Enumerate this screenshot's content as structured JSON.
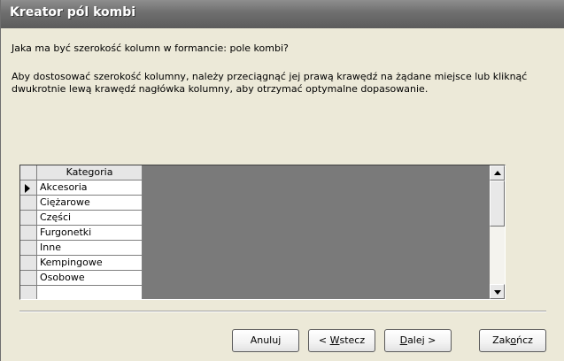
{
  "window": {
    "title": "Kreator pól kombi"
  },
  "content": {
    "question": "Jaka ma być szerokość kolumn w formancie: pole kombi?",
    "instruction": "Aby dostosować szerokość kolumny, należy przeciągnąć jej prawą krawędź na żądane miejsce lub kliknąć dwukrotnie lewą krawędź nagłówka kolumny, aby otrzymać optymalne dopasowanie."
  },
  "grid": {
    "column_header": "Kategoria",
    "rows": [
      "Akcesoria",
      "Ciężarowe",
      "Części",
      "Furgonetki",
      "Inne",
      "Kempingowe",
      "Osobowe"
    ],
    "selected_row": 0
  },
  "buttons": {
    "cancel": {
      "label": "Anuluj"
    },
    "back": {
      "pre": "< ",
      "accel": "W",
      "post": "stecz"
    },
    "next": {
      "pre": "",
      "accel": "D",
      "post": "alej >"
    },
    "finish": {
      "pre": "Zak",
      "accel": "o",
      "post": "ńcz"
    }
  },
  "colors": {
    "titlebar": "#6e6e6e",
    "dialog_bg": "#ece9d8",
    "grid_empty_area": "#7a7a7a"
  }
}
